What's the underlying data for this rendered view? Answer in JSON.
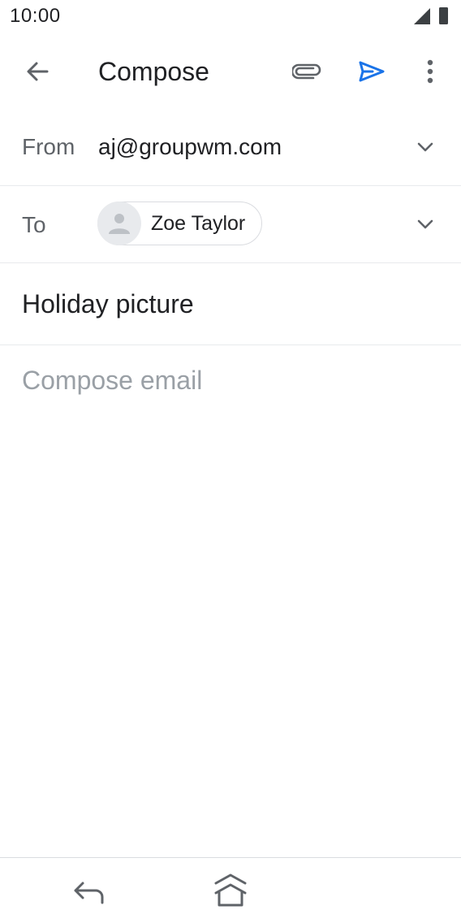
{
  "status_bar": {
    "time": "10:00",
    "icons": [
      "signal-icon",
      "battery-icon"
    ]
  },
  "app_bar": {
    "title": "Compose",
    "icons": [
      "back-arrow-icon",
      "paperclip-icon",
      "send-icon",
      "more-vert-icon"
    ],
    "accent_color": "#1a73e8"
  },
  "from": {
    "label": "From",
    "value": "aj@groupwm.com"
  },
  "to": {
    "label": "To",
    "recipients": [
      {
        "name": "Zoe Taylor"
      }
    ]
  },
  "subject": {
    "value": "Holiday picture"
  },
  "body": {
    "placeholder": "Compose email"
  },
  "nav_bar": {
    "icons": [
      "nav-back-icon",
      "nav-home-icon"
    ]
  }
}
